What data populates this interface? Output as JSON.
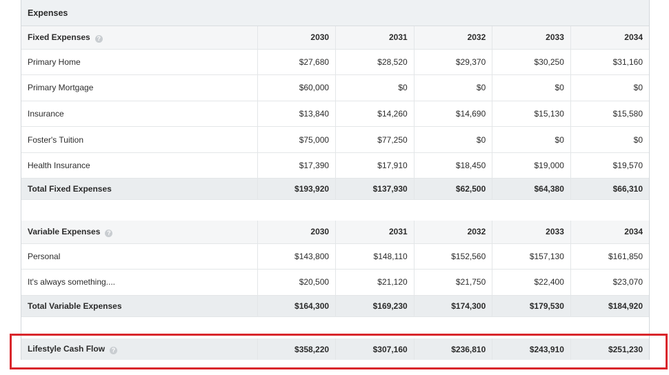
{
  "panel": {
    "title": "Expenses"
  },
  "fixed": {
    "title": "Fixed Expenses",
    "years": [
      "2030",
      "2031",
      "2032",
      "2033",
      "2034"
    ],
    "rows": [
      {
        "label": "Primary Home",
        "values": [
          "$27,680",
          "$28,520",
          "$29,370",
          "$30,250",
          "$31,160"
        ]
      },
      {
        "label": "Primary Mortgage",
        "values": [
          "$60,000",
          "$0",
          "$0",
          "$0",
          "$0"
        ]
      },
      {
        "label": "Insurance",
        "values": [
          "$13,840",
          "$14,260",
          "$14,690",
          "$15,130",
          "$15,580"
        ]
      },
      {
        "label": "Foster's Tuition",
        "values": [
          "$75,000",
          "$77,250",
          "$0",
          "$0",
          "$0"
        ]
      },
      {
        "label": "Health Insurance",
        "values": [
          "$17,390",
          "$17,910",
          "$18,450",
          "$19,000",
          "$19,570"
        ]
      }
    ],
    "total": {
      "label": "Total Fixed Expenses",
      "values": [
        "$193,920",
        "$137,930",
        "$62,500",
        "$64,380",
        "$66,310"
      ]
    }
  },
  "variable": {
    "title": "Variable Expenses",
    "years": [
      "2030",
      "2031",
      "2032",
      "2033",
      "2034"
    ],
    "rows": [
      {
        "label": "Personal",
        "values": [
          "$143,800",
          "$148,110",
          "$152,560",
          "$157,130",
          "$161,850"
        ]
      },
      {
        "label": "It's always something....",
        "values": [
          "$20,500",
          "$21,120",
          "$21,750",
          "$22,400",
          "$23,070"
        ]
      }
    ],
    "total": {
      "label": "Total Variable Expenses",
      "values": [
        "$164,300",
        "$169,230",
        "$174,300",
        "$179,530",
        "$184,920"
      ]
    }
  },
  "cashflow": {
    "label": "Lifestyle Cash Flow",
    "values": [
      "$358,220",
      "$307,160",
      "$236,810",
      "$243,910",
      "$251,230"
    ]
  },
  "icons": {
    "help": "help-circle-icon"
  },
  "colors": {
    "highlight": "#d9262b",
    "header_bg": "#eef1f3",
    "total_bg": "#eaedef"
  }
}
